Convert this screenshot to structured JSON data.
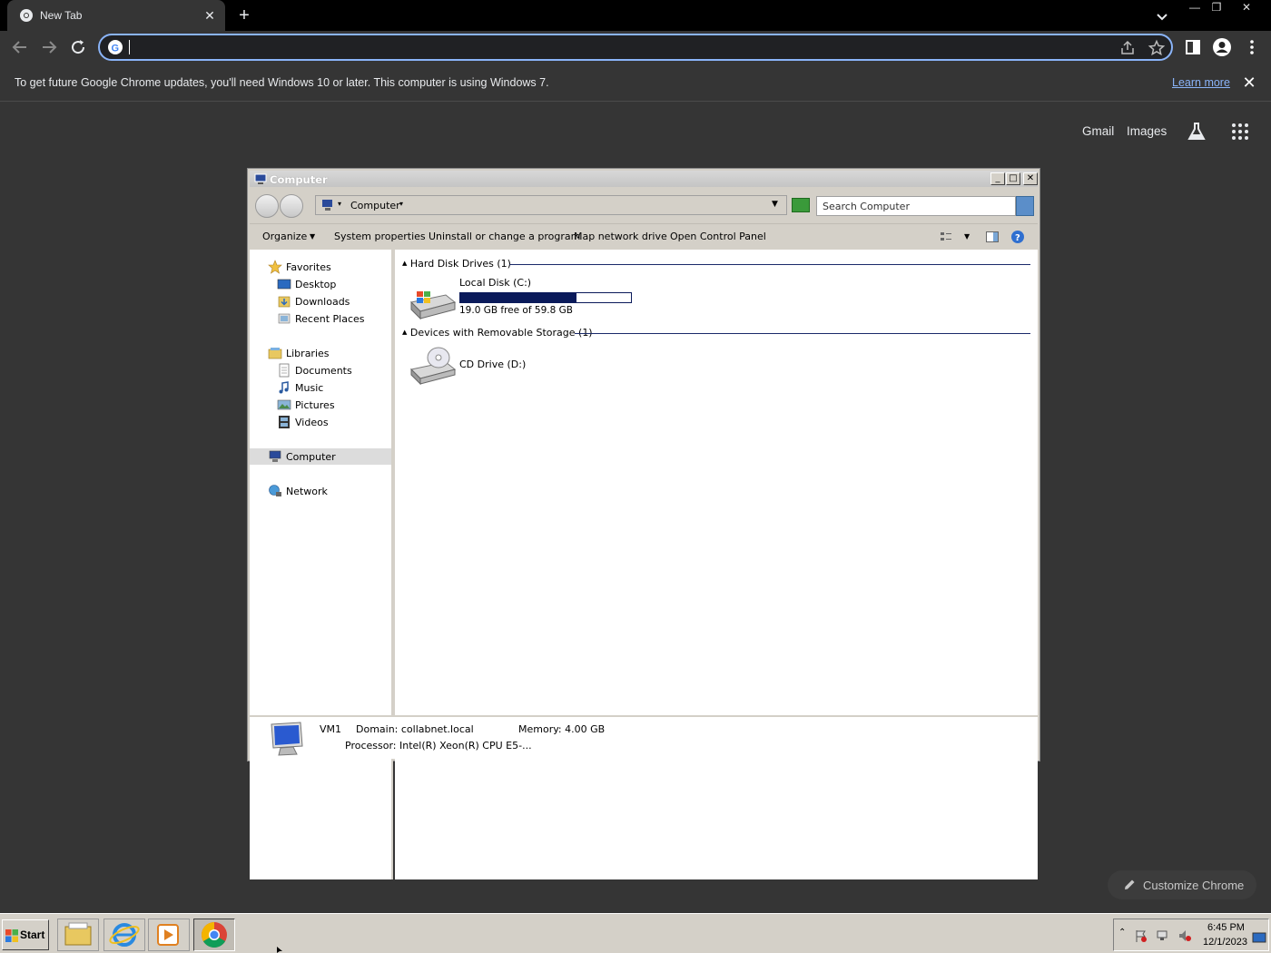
{
  "browser": {
    "tab": {
      "title": "New Tab",
      "close": "✕"
    },
    "new_tab": "+",
    "window_controls": {
      "minimize": "—",
      "restore": "❐",
      "close": "✕"
    },
    "omnibox": {
      "value": ""
    },
    "infobar": {
      "message": "To get future Google Chrome updates, you'll need Windows 10 or later. This computer is using Windows 7.",
      "link": "Learn more",
      "close": "✕"
    },
    "ntp": {
      "links": [
        "Gmail",
        "Images"
      ],
      "customize": "Customize Chrome"
    }
  },
  "explorer": {
    "title": "Computer",
    "address": "Computer",
    "search_placeholder": "Search Computer",
    "commands": [
      "Organize",
      "System properties",
      "Uninstall or change a program",
      "Map network drive",
      "Open Control Panel"
    ],
    "nav": {
      "favorites": "Favorites",
      "desktop": "Desktop",
      "downloads": "Downloads",
      "recent": "Recent Places",
      "libraries": "Libraries",
      "documents": "Documents",
      "music": "Music",
      "pictures": "Pictures",
      "videos": "Videos",
      "computer": "Computer",
      "network": "Network"
    },
    "groups": {
      "hdd": "Hard Disk Drives (1)",
      "removable": "Devices with Removable Storage (1)"
    },
    "drives": {
      "c_label": "Local Disk (C:)",
      "c_free": "19.0 GB free of 59.8 GB",
      "c_used_fraction": 0.68,
      "d_label": "CD Drive (D:)"
    },
    "details": {
      "name": "VM1",
      "domain": "Domain: collabnet.local",
      "memory": "Memory: 4.00 GB",
      "processor": "Processor: Intel(R) Xeon(R) CPU E5-..."
    }
  },
  "taskbar": {
    "start": "Start",
    "time": "6:45 PM",
    "date": "12/1/2023"
  },
  "colors": {
    "chrome_bg": "#353535",
    "accent_blue": "#8ab4f8",
    "drive_bar": "#0a1a5a"
  }
}
